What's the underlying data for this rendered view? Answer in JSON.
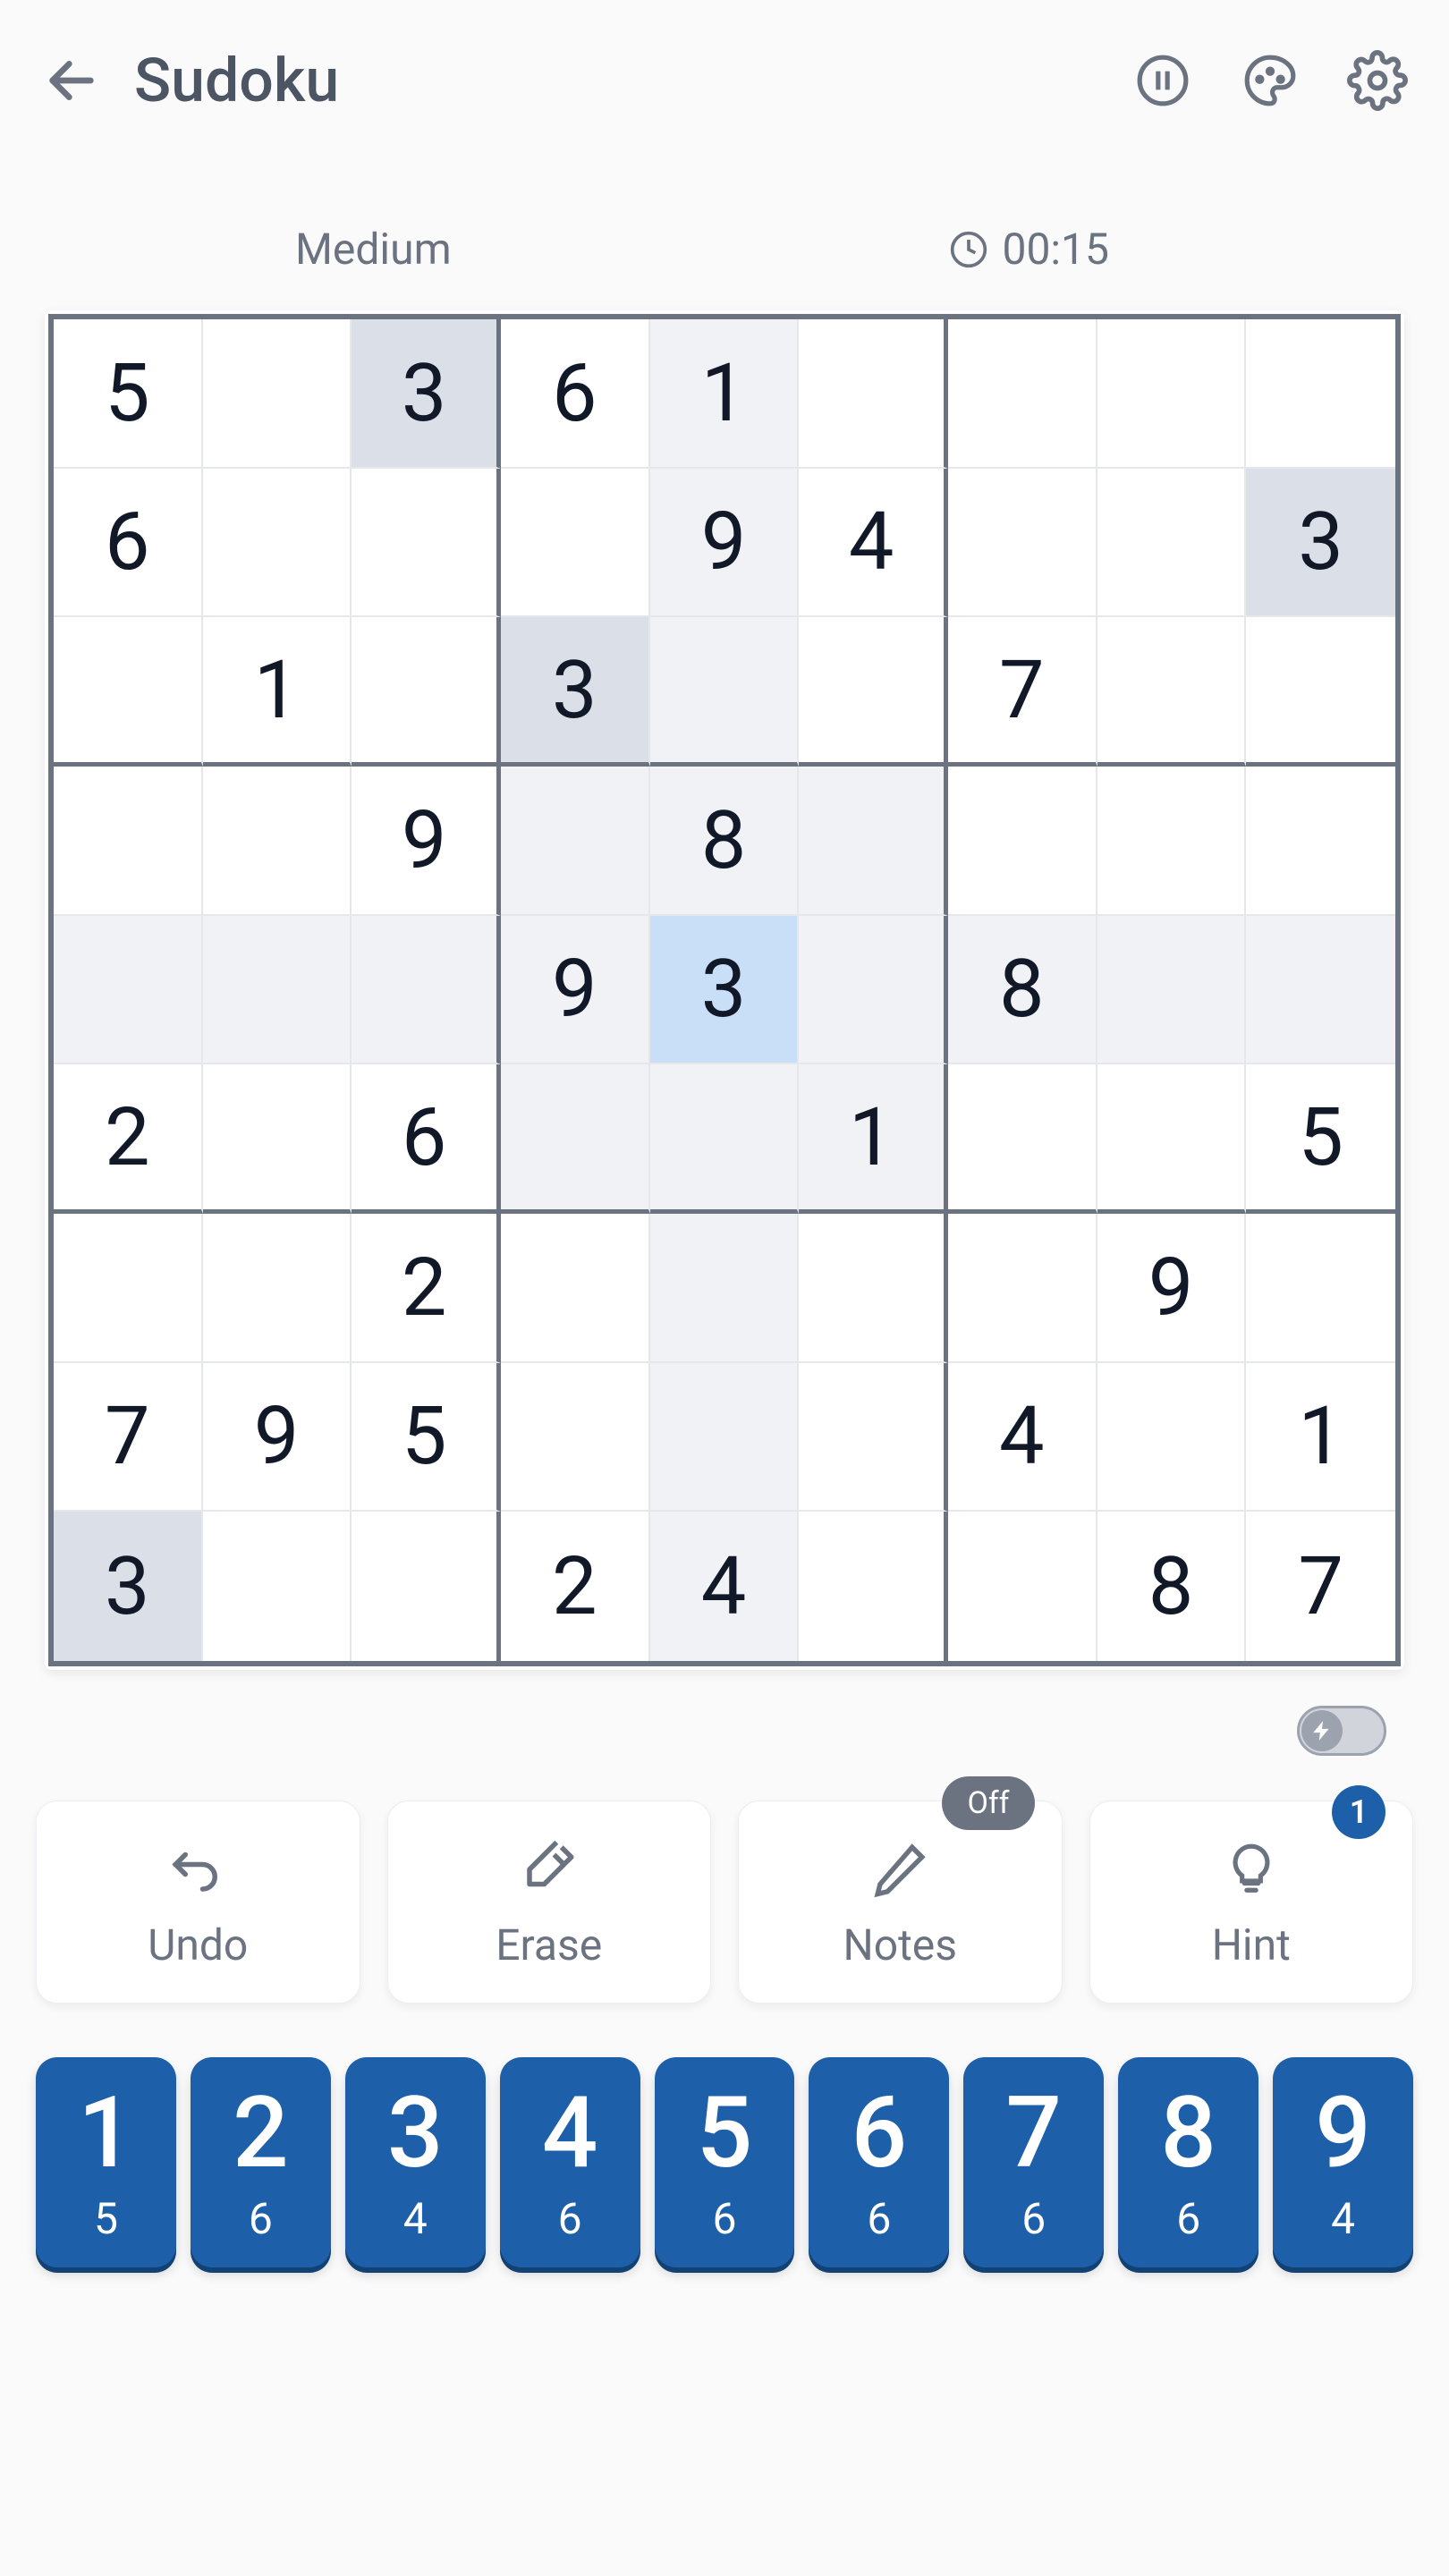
{
  "header": {
    "title": "Sudoku"
  },
  "meta": {
    "difficulty": "Medium",
    "timer": "00:15"
  },
  "selected": {
    "row": 4,
    "col": 4
  },
  "board": [
    [
      "5",
      "",
      "3",
      "6",
      "1",
      "",
      "",
      "",
      ""
    ],
    [
      "6",
      "",
      "",
      "",
      "9",
      "4",
      "",
      "",
      "3"
    ],
    [
      "",
      "1",
      "",
      "3",
      "",
      "",
      "7",
      "",
      ""
    ],
    [
      "",
      "",
      "9",
      "",
      "8",
      "",
      "",
      "",
      ""
    ],
    [
      "",
      "",
      "",
      "9",
      "3",
      "",
      "8",
      "",
      ""
    ],
    [
      "2",
      "",
      "6",
      "",
      "",
      "1",
      "",
      "",
      "5"
    ],
    [
      "",
      "",
      "2",
      "",
      "",
      "",
      "",
      "9",
      ""
    ],
    [
      "7",
      "9",
      "5",
      "",
      "",
      "",
      "4",
      "",
      "1"
    ],
    [
      "3",
      "",
      "",
      "2",
      "4",
      "",
      "",
      "8",
      "7"
    ]
  ],
  "actions": {
    "undo": "Undo",
    "erase": "Erase",
    "notes": "Notes",
    "notes_state": "Off",
    "hint": "Hint",
    "hint_badge": "1"
  },
  "numpad": [
    {
      "digit": "1",
      "remaining": "5"
    },
    {
      "digit": "2",
      "remaining": "6"
    },
    {
      "digit": "3",
      "remaining": "4"
    },
    {
      "digit": "4",
      "remaining": "6"
    },
    {
      "digit": "5",
      "remaining": "6"
    },
    {
      "digit": "6",
      "remaining": "6"
    },
    {
      "digit": "7",
      "remaining": "6"
    },
    {
      "digit": "8",
      "remaining": "6"
    },
    {
      "digit": "9",
      "remaining": "4"
    }
  ]
}
